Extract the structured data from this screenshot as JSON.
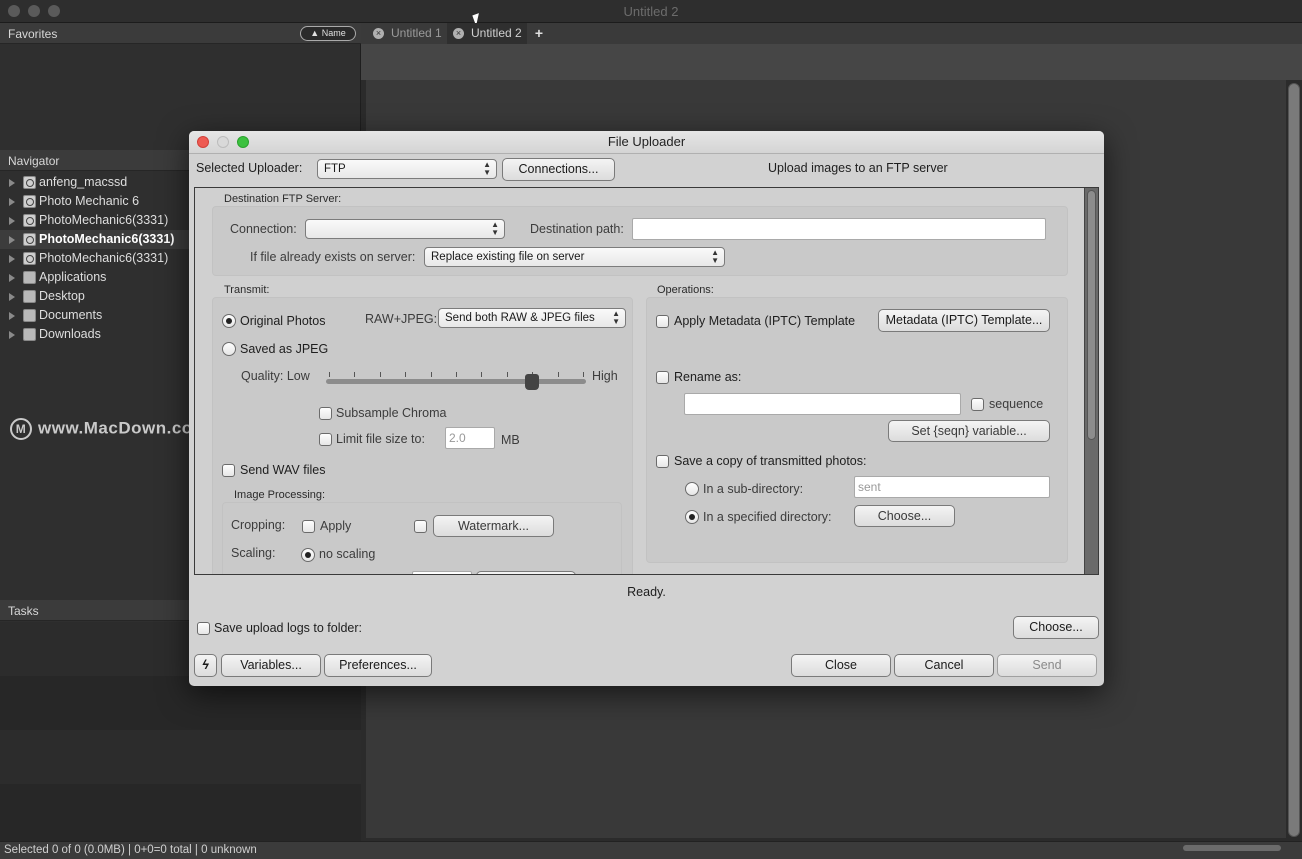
{
  "window": {
    "title": "Untitled 2"
  },
  "left_panel": {
    "favorites_label": "Favorites",
    "sort_button": "▲ Name",
    "navigator_label": "Navigator",
    "navigator_items": [
      {
        "label": "anfeng_macssd",
        "icon": "drive-icon",
        "selected": false
      },
      {
        "label": "Photo Mechanic 6",
        "icon": "disk-image-icon",
        "selected": false
      },
      {
        "label": "PhotoMechanic6(3331)",
        "icon": "disk-image-icon",
        "selected": false
      },
      {
        "label": "PhotoMechanic6(3331)",
        "icon": "disk-image-icon",
        "selected": true
      },
      {
        "label": "PhotoMechanic6(3331)",
        "icon": "disk-image-icon",
        "selected": false
      },
      {
        "label": "Applications",
        "icon": "folder-icon",
        "selected": false
      },
      {
        "label": "Desktop",
        "icon": "folder-icon",
        "selected": false
      },
      {
        "label": "Documents",
        "icon": "folder-icon",
        "selected": false
      },
      {
        "label": "Downloads",
        "icon": "folder-icon",
        "selected": false
      }
    ],
    "tasks_label": "Tasks"
  },
  "watermark": {
    "logo": "M",
    "text": "www.MacDown.com"
  },
  "tabs": [
    {
      "label": "Untitled 1",
      "active": false
    },
    {
      "label": "Untitled 2",
      "active": true
    }
  ],
  "statusbar": {
    "text": "Selected 0 of 0 (0.0MB) | 0+0=0 total | 0 unknown"
  },
  "dialog": {
    "title": "File Uploader",
    "selected_uploader_label": "Selected Uploader:",
    "selected_uploader_value": "FTP",
    "connections_button": "Connections...",
    "description": "Upload images to an FTP server",
    "destination": {
      "group_label": "Destination FTP Server:",
      "connection_label": "Connection:",
      "connection_value": "",
      "path_label": "Destination path:",
      "path_value": "",
      "exists_label": "If file already exists on server:",
      "exists_value": "Replace existing file on server"
    },
    "transmit": {
      "group_label": "Transmit:",
      "original_photos": "Original Photos",
      "original_selected": true,
      "raw_jpeg_label": "RAW+JPEG:",
      "raw_jpeg_value": "Send both RAW & JPEG files",
      "saved_as_jpeg": "Saved as JPEG",
      "saved_selected": false,
      "quality_label": "Quality: Low",
      "quality_high": "High",
      "quality_fraction": 0.8,
      "subsample_chroma": "Subsample Chroma",
      "limit_file_size": "Limit file size to:",
      "limit_value": "2.0",
      "limit_unit": "MB",
      "send_wav": "Send WAV files"
    },
    "image_processing": {
      "group_label": "Image Processing:",
      "cropping_label": "Cropping:",
      "apply_label": "Apply",
      "watermark_button": "Watermark...",
      "scaling_label": "Scaling:",
      "no_scaling": "no scaling"
    },
    "operations": {
      "group_label": "Operations:",
      "apply_metadata": "Apply Metadata (IPTC) Template",
      "metadata_button": "Metadata (IPTC) Template...",
      "rename_as": "Rename as:",
      "rename_value": "",
      "sequence": "sequence",
      "set_seqn_button": "Set {seqn} variable...",
      "save_copy": "Save a copy of transmitted photos:",
      "sub_directory": "In a sub-directory:",
      "sub_directory_value": "sent",
      "specified_directory": "In a specified directory:",
      "choose_button": "Choose..."
    },
    "status": "Ready.",
    "save_logs": "Save upload logs to folder:",
    "logs_choose_button": "Choose...",
    "lightning_button": "ϟ",
    "variables_button": "Variables...",
    "preferences_button": "Preferences...",
    "close_button": "Close",
    "cancel_button": "Cancel",
    "send_button": "Send"
  },
  "colors": {
    "close_red": "#ee5a52",
    "zoom_green": "#3cc13f",
    "dialog_bg": "#d2d2d2",
    "app_bg": "#2f2f2f"
  }
}
